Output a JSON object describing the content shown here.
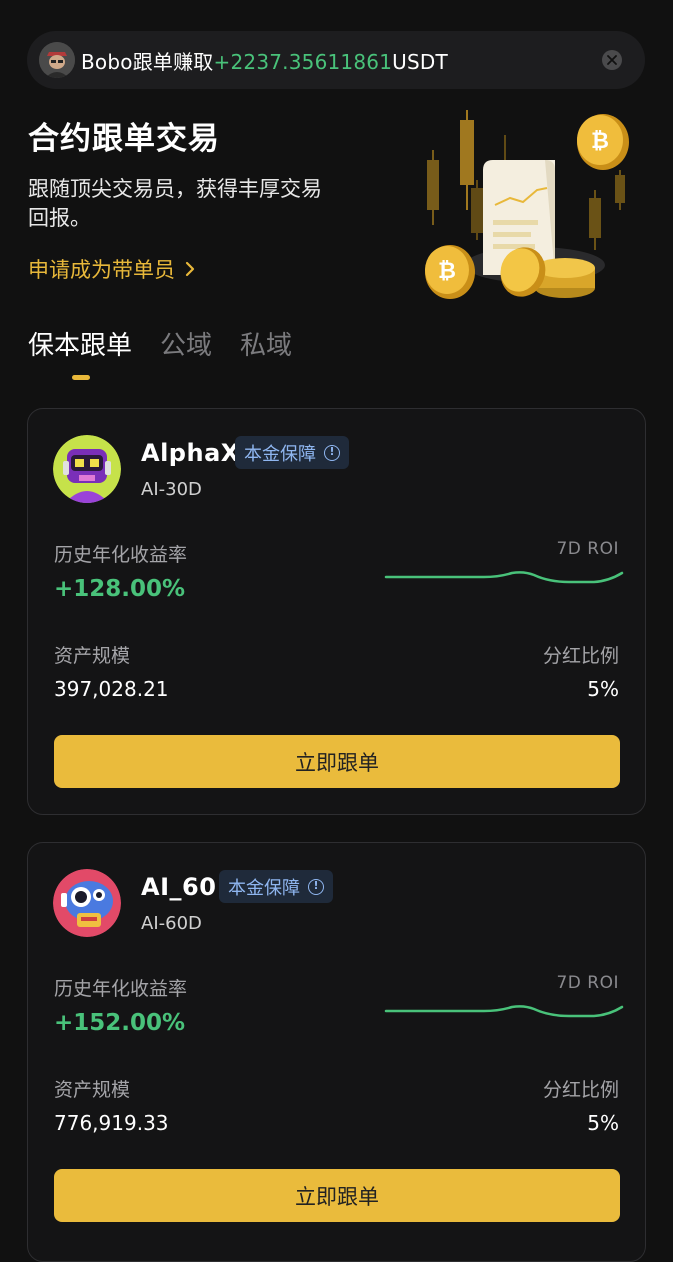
{
  "notice": {
    "user": "Bobo",
    "action": "跟单赚取",
    "amount": "+2237.35611861",
    "unit": "USDT"
  },
  "hero": {
    "title": "合约跟单交易",
    "subtitle": "跟随顶尖交易员，获得丰厚交易回报。",
    "apply_link": "申请成为带单员"
  },
  "tabs": [
    {
      "label": "保本跟单",
      "active": true
    },
    {
      "label": "公域",
      "active": false
    },
    {
      "label": "私域",
      "active": false
    }
  ],
  "traders": [
    {
      "name": "AlphaX",
      "badge": "本金保障",
      "subtitle": "AI-30D",
      "roi_label": "历史年化收益率",
      "roi_value": "+128.00%",
      "chart_label": "7D ROI",
      "aum_label": "资产规模",
      "aum_value": "397,028.21",
      "share_label": "分红比例",
      "share_value": "5%",
      "cta": "立即跟单"
    },
    {
      "name": "AI_60",
      "badge": "本金保障",
      "subtitle": "AI-60D",
      "roi_label": "历史年化收益率",
      "roi_value": "+152.00%",
      "chart_label": "7D ROI",
      "aum_label": "资产规模",
      "aum_value": "776,919.33",
      "share_label": "分红比例",
      "share_value": "5%",
      "cta": "立即跟单"
    }
  ],
  "colors": {
    "accent": "#eabb3c",
    "positive": "#49c27a",
    "badge_text": "#8fb6f0",
    "background": "#111111"
  }
}
